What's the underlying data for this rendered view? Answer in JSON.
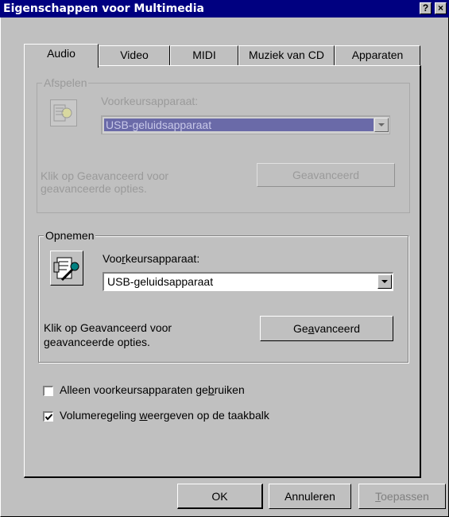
{
  "window": {
    "title": "Eigenschappen voor Multimedia",
    "help_btn": "?",
    "close_btn": "×"
  },
  "tabs": [
    {
      "label": "Audio",
      "active": true
    },
    {
      "label": "Video"
    },
    {
      "label": "MIDI"
    },
    {
      "label": "Muziek van CD"
    },
    {
      "label": "Apparaten"
    }
  ],
  "playback": {
    "group_label": "Afspelen",
    "pref_label": "Voorkeursapparaat:",
    "device": "USB-geluidsapparaat",
    "note_line1": "Klik op Geavanceerd voor",
    "note_line2": "geavanceerde opties.",
    "advanced_btn": "Geavanceerd"
  },
  "recording": {
    "group_label": "Opnemen",
    "pref_label_before": "Voo",
    "pref_label_u": "r",
    "pref_label_after": "keursapparaat:",
    "device": "USB-geluidsapparaat",
    "note_line1": "Klik op Geavanceerd voor",
    "note_line2": "geavanceerde opties.",
    "advanced_before": "Ge",
    "advanced_u": "a",
    "advanced_after": "vanceerd"
  },
  "options": {
    "preferred_only_before": "Alleen voorkeursapparaten ge",
    "preferred_only_u": "b",
    "preferred_only_after": "ruiken",
    "preferred_only_checked": false,
    "volume_before": "Volumeregeling ",
    "volume_u": "w",
    "volume_after": "eergeven op de taakbalk",
    "volume_checked": true
  },
  "footer": {
    "ok": "OK",
    "cancel": "Annuleren",
    "apply_u": "T",
    "apply_after": "oepassen"
  }
}
